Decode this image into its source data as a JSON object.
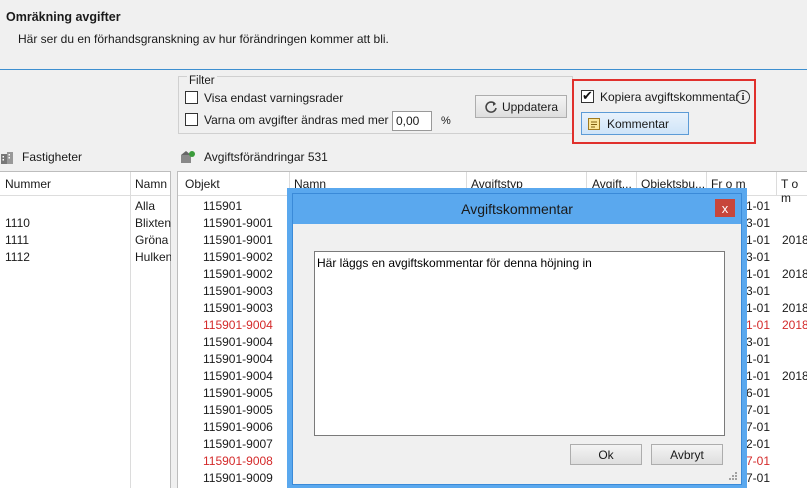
{
  "header": {
    "title": "Omräkning avgifter",
    "subtitle": "Här ser du en förhandsgranskning av hur förändringen kommer att bli."
  },
  "filter": {
    "legend": "Filter",
    "warn_rows_only_label": "Visa endast varningsrader",
    "warn_change_label": "Varna om avgifter ändras med mer än",
    "warn_change_value": "0,00",
    "percent_label": "%",
    "update_button": "Uppdatera"
  },
  "options": {
    "copy_comment_label": "Kopiera avgiftskommentar",
    "copy_comment_checked": true,
    "comment_button": "Kommentar"
  },
  "properties": {
    "section_label": "Fastigheter",
    "columns": [
      "Nummer",
      "Namn"
    ],
    "rows": [
      {
        "nummer": "",
        "namn": "Alla"
      },
      {
        "nummer": "1110",
        "namn": "Blixten"
      },
      {
        "nummer": "1111",
        "namn": "Gröna L"
      },
      {
        "nummer": "1112",
        "namn": "Hulken"
      }
    ]
  },
  "changes": {
    "section_label": "Avgiftsförändringar 531",
    "columns": [
      "Objekt",
      "Namn",
      "Avgiftstyp",
      "Avgift...",
      "Objektsbu...",
      "Fr o m",
      "T o m"
    ],
    "rows": [
      {
        "objekt": "115901",
        "from": "1-01",
        "tom": "",
        "warn": false
      },
      {
        "objekt": "115901-9001",
        "from": "3-01",
        "tom": "",
        "warn": false
      },
      {
        "objekt": "115901-9001",
        "from": "1-01",
        "tom": "2018-",
        "warn": false
      },
      {
        "objekt": "115901-9002",
        "from": "3-01",
        "tom": "",
        "warn": false
      },
      {
        "objekt": "115901-9002",
        "from": "1-01",
        "tom": "2018-",
        "warn": false
      },
      {
        "objekt": "115901-9003",
        "from": "3-01",
        "tom": "",
        "warn": false
      },
      {
        "objekt": "115901-9003",
        "from": "1-01",
        "tom": "2018-",
        "warn": false
      },
      {
        "objekt": "115901-9004",
        "from": "1-01",
        "tom": "2018-",
        "warn": true
      },
      {
        "objekt": "115901-9004",
        "from": "3-01",
        "tom": "",
        "warn": false
      },
      {
        "objekt": "115901-9004",
        "from": "1-01",
        "tom": "",
        "warn": false
      },
      {
        "objekt": "115901-9004",
        "from": "1-01",
        "tom": "2018-",
        "warn": false
      },
      {
        "objekt": "115901-9005",
        "from": "6-01",
        "tom": "",
        "warn": false
      },
      {
        "objekt": "115901-9005",
        "from": "7-01",
        "tom": "",
        "warn": false
      },
      {
        "objekt": "115901-9006",
        "from": "7-01",
        "tom": "",
        "warn": false
      },
      {
        "objekt": "115901-9007",
        "from": "2-01",
        "tom": "",
        "warn": false
      },
      {
        "objekt": "115901-9008",
        "from": "7-01",
        "tom": "",
        "warn": true
      },
      {
        "objekt": "115901-9009",
        "from": "7-01",
        "tom": "",
        "warn": false
      }
    ]
  },
  "dialog": {
    "title": "Avgiftskommentar",
    "close_glyph": "x",
    "comment_text": "Här läggs en avgiftskommentar för denna höjning in",
    "ok_button": "Ok",
    "cancel_button": "Avbryt"
  },
  "colors": {
    "accent": "#5aa8ee",
    "warning_text": "#d42a2a",
    "highlight_border": "#e0302c"
  }
}
